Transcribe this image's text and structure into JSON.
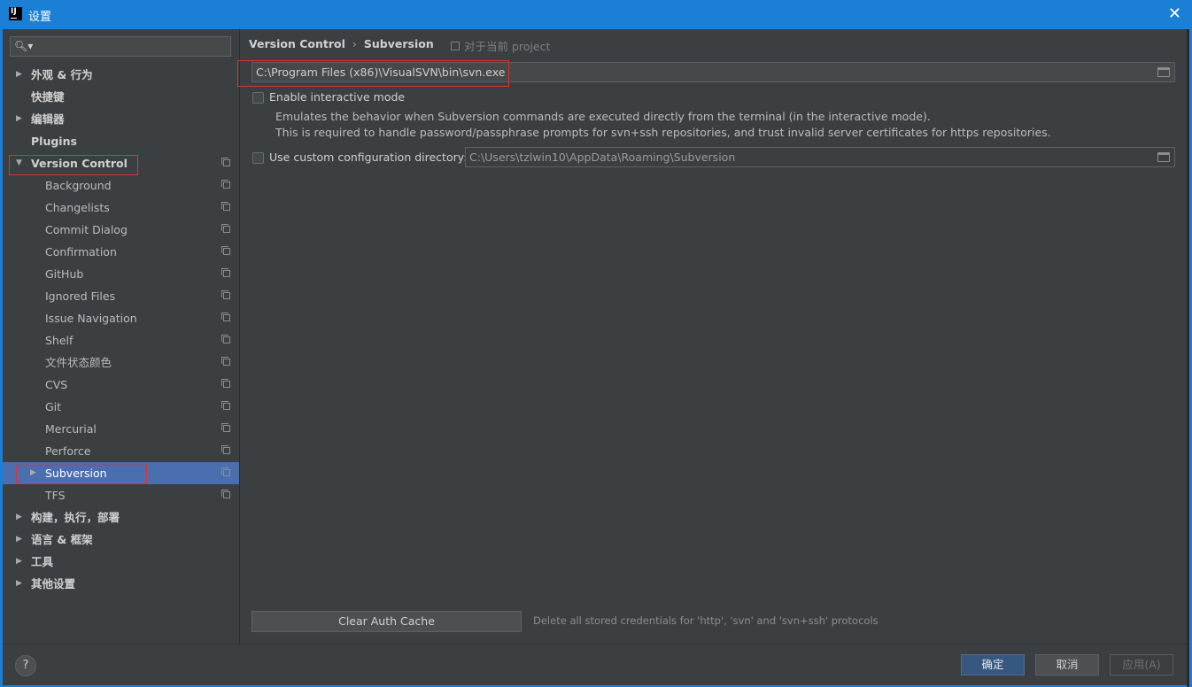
{
  "window": {
    "title": "设置",
    "close_glyph": "✕",
    "app_icon_text": "IJ"
  },
  "search": {
    "placeholder": "",
    "icon": "search-icon"
  },
  "sidebar": {
    "items": [
      {
        "label": "外观 & 行为",
        "arrow": "▶",
        "bold": true,
        "proj": false
      },
      {
        "label": "快捷键",
        "arrow": "",
        "bold": true,
        "proj": false
      },
      {
        "label": "编辑器",
        "arrow": "▶",
        "bold": true,
        "proj": false
      },
      {
        "label": "Plugins",
        "arrow": "",
        "bold": true,
        "proj": false
      },
      {
        "label": "Version Control",
        "arrow": "▼",
        "bold": true,
        "proj": true
      },
      {
        "label": "Background",
        "arrow": "",
        "bold": false,
        "proj": true
      },
      {
        "label": "Changelists",
        "arrow": "",
        "bold": false,
        "proj": true
      },
      {
        "label": "Commit Dialog",
        "arrow": "",
        "bold": false,
        "proj": true
      },
      {
        "label": "Confirmation",
        "arrow": "",
        "bold": false,
        "proj": true
      },
      {
        "label": "GitHub",
        "arrow": "",
        "bold": false,
        "proj": true
      },
      {
        "label": "Ignored Files",
        "arrow": "",
        "bold": false,
        "proj": true
      },
      {
        "label": "Issue Navigation",
        "arrow": "",
        "bold": false,
        "proj": true
      },
      {
        "label": "Shelf",
        "arrow": "",
        "bold": false,
        "proj": true
      },
      {
        "label": "文件状态颜色",
        "arrow": "",
        "bold": false,
        "proj": true
      },
      {
        "label": "CVS",
        "arrow": "",
        "bold": false,
        "proj": true
      },
      {
        "label": "Git",
        "arrow": "",
        "bold": false,
        "proj": true
      },
      {
        "label": "Mercurial",
        "arrow": "",
        "bold": false,
        "proj": true
      },
      {
        "label": "Perforce",
        "arrow": "",
        "bold": false,
        "proj": true
      },
      {
        "label": "Subversion",
        "arrow": "▶",
        "bold": false,
        "proj": true,
        "selected": true
      },
      {
        "label": "TFS",
        "arrow": "",
        "bold": false,
        "proj": true
      },
      {
        "label": "构建，执行，部署",
        "arrow": "▶",
        "bold": true,
        "proj": false
      },
      {
        "label": "语言 & 框架",
        "arrow": "▶",
        "bold": true,
        "proj": false
      },
      {
        "label": "工具",
        "arrow": "▶",
        "bold": true,
        "proj": false
      },
      {
        "label": "其他设置",
        "arrow": "▶",
        "bold": true,
        "proj": false
      }
    ]
  },
  "main": {
    "breadcrumb": {
      "parent": "Version Control",
      "separator": "›",
      "current": "Subversion"
    },
    "scope_label": "对于当前 project",
    "svn_path": "C:\\Program Files (x86)\\VisualSVN\\bin\\svn.exe",
    "interactive_mode": {
      "label": "Enable interactive mode",
      "checked": false,
      "desc_line1": "Emulates the behavior when Subversion commands are executed directly from the terminal (in the interactive mode).",
      "desc_line2": "This is required to handle password/passphrase prompts for svn+ssh repositories, and trust invalid server certificates for https repositories."
    },
    "custom_config": {
      "label": "Use custom configuration directory:",
      "checked": false,
      "value": "C:\\Users\\tzlwin10\\AppData\\Roaming\\Subversion"
    },
    "clear_auth_button": "Clear Auth Cache",
    "clear_auth_desc": "Delete all stored credentials for 'http', 'svn' and 'svn+ssh' protocols"
  },
  "footer": {
    "help_label": "?",
    "ok_label": "确定",
    "cancel_label": "取消",
    "apply_label": "应用(A)"
  },
  "colors": {
    "titlebar": "#1c7fd6",
    "panel": "#3c3f41",
    "selection": "#4b6eaf",
    "highlight_box": "#e03131",
    "primary_button": "#365880"
  }
}
